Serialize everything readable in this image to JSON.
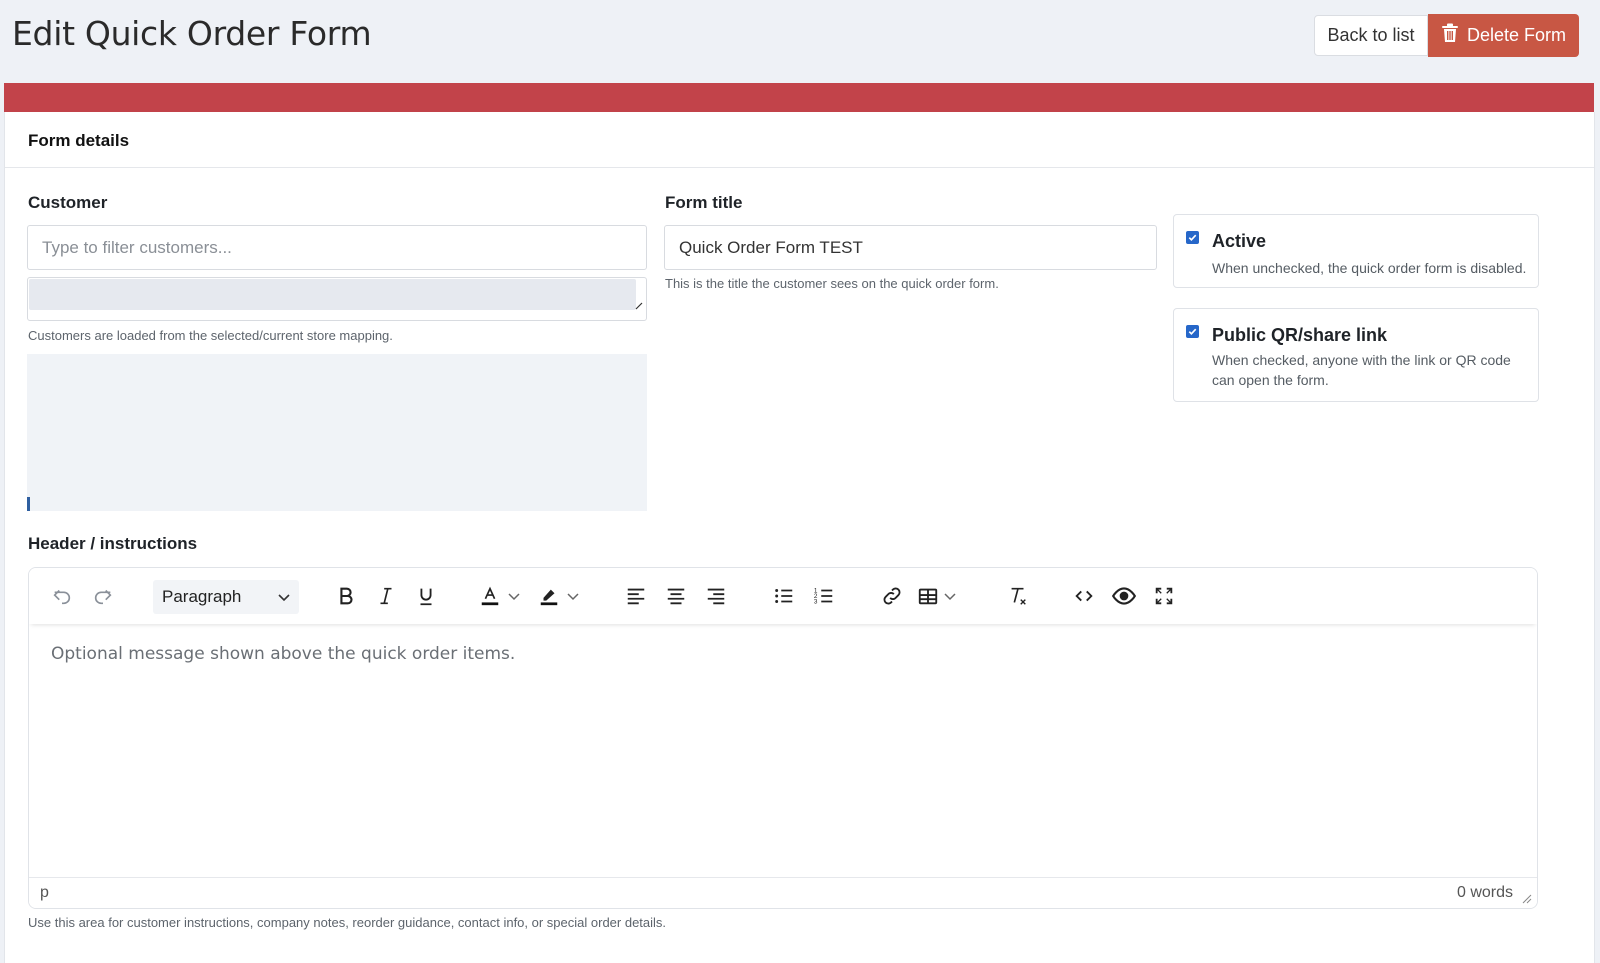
{
  "page": {
    "title": "Edit Quick Order Form",
    "back_label": "Back to list",
    "delete_label": "Delete Form"
  },
  "colors": {
    "danger_button": "#c85744",
    "alert_bar": "#c2434a",
    "checkbox": "#2667c9"
  },
  "card": {
    "title": "Form details"
  },
  "customer": {
    "label": "Customer",
    "filter_placeholder": "Type to filter customers...",
    "selected_value": "",
    "help": "Customers are loaded from the selected/current store mapping."
  },
  "form_title": {
    "label": "Form title",
    "value": "Quick Order Form TEST",
    "help": "This is the title the customer sees on the quick order form."
  },
  "active": {
    "checked": true,
    "label": "Active",
    "description": "When unchecked, the quick order form is disabled."
  },
  "public_link": {
    "checked": true,
    "label": "Public QR/share link",
    "description": "When checked, anyone with the link or QR code can open the form."
  },
  "header": {
    "label": "Header / instructions",
    "block_format": "Paragraph",
    "placeholder": "Optional message shown above the quick order items.",
    "status_path": "p",
    "word_count": "0 words",
    "help": "Use this area for customer instructions, company notes, reorder guidance, contact info, or special order details."
  },
  "toolbar_icons": [
    "undo-icon",
    "redo-icon",
    "bold-icon",
    "italic-icon",
    "underline-icon",
    "text-color-icon",
    "highlight-icon",
    "align-left-icon",
    "align-center-icon",
    "align-right-icon",
    "bullet-list-icon",
    "numbered-list-icon",
    "link-icon",
    "table-icon",
    "clear-format-icon",
    "source-code-icon",
    "preview-icon",
    "fullscreen-icon"
  ]
}
